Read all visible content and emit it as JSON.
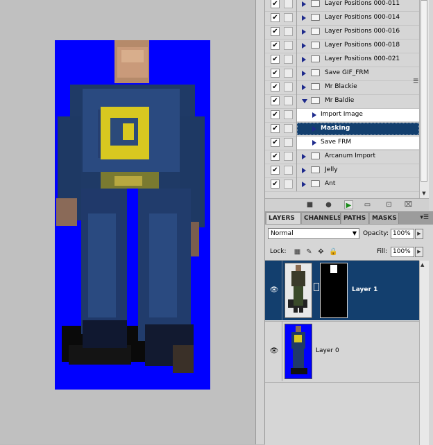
{
  "actions_panel": {
    "items": [
      {
        "label": "Layer Positions 000-011",
        "checked": true,
        "kind": "action",
        "state": "closed"
      },
      {
        "label": "Layer Positions 000-014",
        "checked": true,
        "kind": "action",
        "state": "closed"
      },
      {
        "label": "Layer Positions 000-016",
        "checked": true,
        "kind": "action",
        "state": "closed"
      },
      {
        "label": "Layer Positions 000-018",
        "checked": true,
        "kind": "action",
        "state": "closed"
      },
      {
        "label": "Layer Positions 000-021",
        "checked": true,
        "kind": "action",
        "state": "closed"
      },
      {
        "label": "Save GIF_FRM",
        "checked": true,
        "kind": "action",
        "state": "closed"
      },
      {
        "label": "Mr Blackie",
        "checked": true,
        "kind": "set",
        "state": "closed"
      },
      {
        "label": "Mr Baldie",
        "checked": true,
        "kind": "set",
        "state": "open"
      },
      {
        "label": "Import Image",
        "checked": true,
        "kind": "child",
        "state": "closed"
      },
      {
        "label": "Masking",
        "checked": true,
        "kind": "child",
        "state": "selected"
      },
      {
        "label": "Save FRM",
        "checked": true,
        "kind": "child",
        "state": "closed"
      },
      {
        "label": "Arcanum Import",
        "checked": true,
        "kind": "set",
        "state": "closed"
      },
      {
        "label": "Jelly",
        "checked": true,
        "kind": "set",
        "state": "closed"
      },
      {
        "label": "Ant",
        "checked": true,
        "kind": "set",
        "state": "closed"
      }
    ],
    "check_glyph": "✔",
    "toolbar_icons": [
      "stop-icon",
      "record-icon",
      "play-icon",
      "new-set-icon",
      "new-action-icon",
      "trash-icon"
    ]
  },
  "layers_panel": {
    "tabs": [
      "LAYERS",
      "CHANNELS",
      "PATHS",
      "MASKS"
    ],
    "active_tab": "LAYERS",
    "blend_mode": "Normal",
    "opacity_label": "Opacity:",
    "opacity_value": "100%",
    "lock_label": "Lock:",
    "fill_label": "Fill:",
    "fill_value": "100%",
    "layers": [
      {
        "name": "Layer 1",
        "selected": true,
        "has_mask": true,
        "visible": true
      },
      {
        "name": "Layer 0",
        "selected": false,
        "has_mask": false,
        "visible": true
      }
    ]
  },
  "colors": {
    "canvas_background": "#0000ff",
    "selection": "#133f6e",
    "workspace": "#c0c0c0",
    "panel": "#d6d6d6"
  }
}
